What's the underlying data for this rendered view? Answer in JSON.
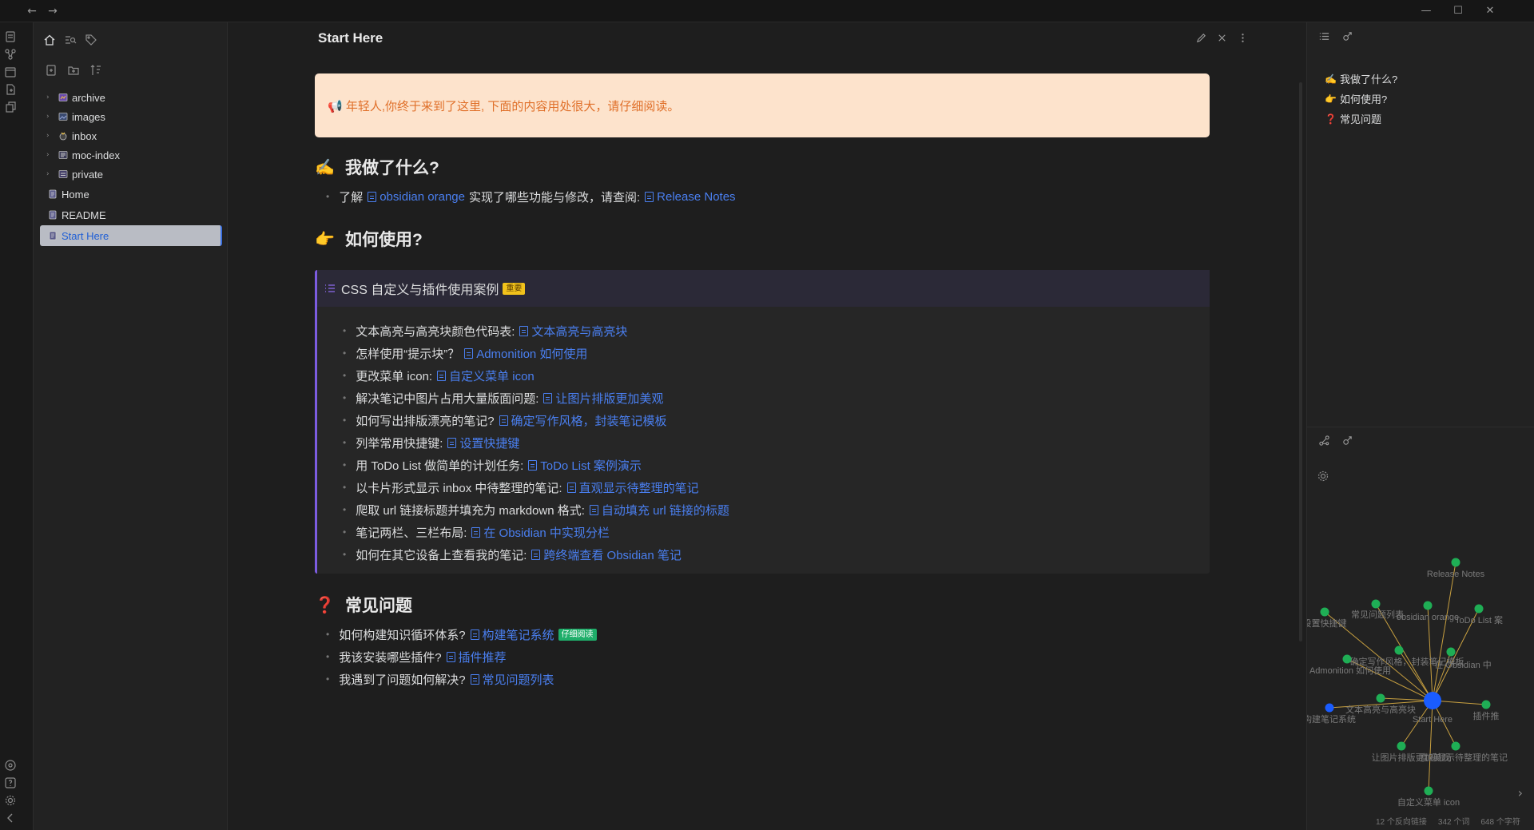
{
  "titlebar": {
    "back": "←",
    "forward": "→",
    "minimize": "—",
    "maximize": "☐",
    "close": "✕"
  },
  "sidebar": {
    "folders": [
      {
        "label": "archive"
      },
      {
        "label": "images"
      },
      {
        "label": "inbox"
      },
      {
        "label": "moc-index"
      },
      {
        "label": "private"
      }
    ],
    "files": [
      {
        "label": "Home"
      },
      {
        "label": "README"
      },
      {
        "label": "Start Here"
      }
    ]
  },
  "note": {
    "title": "Start Here",
    "warning": "📢 年轻人,你终于来到了这里, 下面的内容用处很大，请仔细阅读。",
    "sec1": {
      "emoji": "✍️",
      "heading": "我做了什么?",
      "text1": "了解",
      "link1": "obsidian orange",
      "text2": "实现了哪些功能与修改，请查阅:",
      "link2": "Release Notes"
    },
    "sec2": {
      "emoji": "👉",
      "heading": "如何使用?",
      "callout_title": "CSS 自定义与插件使用案例",
      "callout_badge": "重要",
      "items": [
        {
          "text": "文本高亮与高亮块颜色代码表:",
          "link": "文本高亮与高亮块"
        },
        {
          "text": "怎样使用“提示块”？",
          "link": "Admonition 如何使用"
        },
        {
          "text": "更改菜单 icon:",
          "link": "自定义菜单 icon"
        },
        {
          "text": "解决笔记中图片占用大量版面问题:",
          "link": "让图片排版更加美观"
        },
        {
          "text": "如何写出排版漂亮的笔记?",
          "link": "确定写作风格，封装笔记模板"
        },
        {
          "text": "列举常用快捷键:",
          "link": "设置快捷键"
        },
        {
          "text": "用 ToDo List 做简单的计划任务:",
          "link": "ToDo List 案例演示"
        },
        {
          "text": "以卡片形式显示 inbox 中待整理的笔记:",
          "link": "直观显示待整理的笔记"
        },
        {
          "text": "爬取 url 链接标题并填充为 markdown 格式:",
          "link": "自动填充 url 链接的标题"
        },
        {
          "text": "笔记两栏、三栏布局:",
          "link": "在 Obsidian 中实现分栏"
        },
        {
          "text": "如何在其它设备上查看我的笔记:",
          "link": "跨终端查看 Obsidian 笔记"
        }
      ]
    },
    "sec3": {
      "emoji": "❓",
      "heading": "常见问题",
      "items": [
        {
          "text": "如何构建知识循环体系?",
          "link": "构建笔记系统",
          "badge": "仔细阅读"
        },
        {
          "text": "我该安装哪些插件?",
          "link": "插件推荐"
        },
        {
          "text": "我遇到了问题如何解决?",
          "link": "常见问题列表"
        }
      ]
    }
  },
  "outline": {
    "items": [
      {
        "emoji": "✍️",
        "label": "我做了什么?"
      },
      {
        "emoji": "👉",
        "label": "如何使用?"
      },
      {
        "emoji": "❓",
        "label": "常见问题"
      }
    ]
  },
  "graph": {
    "center": "Start Here",
    "labels": [
      "Release Notes",
      "常见问题列表",
      "obsidian orange",
      "ToDo List 案",
      "设置快捷键",
      "确定写作风格，封装笔记模板",
      "在 Obsidian 中",
      "Admonition 如何使用",
      "文本高亮与高亮块",
      "构建笔记系统",
      "插件推",
      "让图片排版更加美观",
      "直观显示待整理的笔记",
      "自定义菜单 icon"
    ],
    "colors": {
      "node": "#1fae55",
      "center": "#1a5cff",
      "edge": "#c8a040"
    }
  },
  "status": {
    "backlinks": "12 个反向链接",
    "words": "342 个词",
    "chars": "648 个字符"
  }
}
